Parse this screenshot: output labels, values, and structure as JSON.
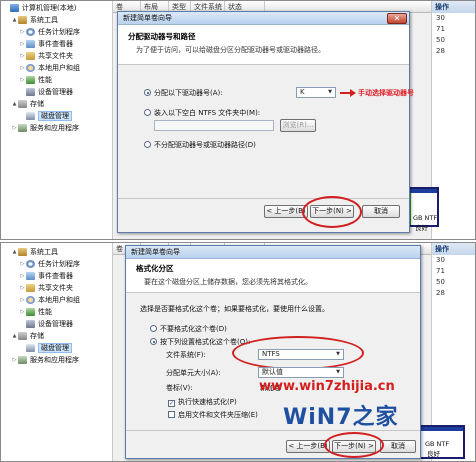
{
  "left_tree": {
    "top": [
      {
        "label": "计算机管理(本地)",
        "icon": "computer-icon",
        "indent": 0,
        "arrow": ""
      },
      {
        "label": "系统工具",
        "icon": "tools-icon",
        "indent": 1,
        "arrow": "▲"
      },
      {
        "label": "任务计划程序",
        "icon": "clock-icon",
        "indent": 2,
        "arrow": "▷"
      },
      {
        "label": "事件查看器",
        "icon": "event-log-icon",
        "indent": 2,
        "arrow": "▷"
      },
      {
        "label": "共享文件夹",
        "icon": "shared-folder-icon",
        "indent": 2,
        "arrow": "▷"
      },
      {
        "label": "本地用户和组",
        "icon": "users-icon",
        "indent": 2,
        "arrow": "▷"
      },
      {
        "label": "性能",
        "icon": "performance-icon",
        "indent": 2,
        "arrow": "▷"
      },
      {
        "label": "设备管理器",
        "icon": "device-manager-icon",
        "indent": 2,
        "arrow": ""
      },
      {
        "label": "存储",
        "icon": "storage-icon",
        "indent": 1,
        "arrow": "▲"
      },
      {
        "label": "磁盘管理",
        "icon": "disk-icon",
        "indent": 2,
        "arrow": "",
        "selected": true
      },
      {
        "label": "服务和应用程序",
        "icon": "services-icon",
        "indent": 1,
        "arrow": "▷"
      }
    ],
    "bottom": [
      {
        "label": "系统工具",
        "icon": "tools-icon",
        "indent": 1,
        "arrow": "▲"
      },
      {
        "label": "任务计划程序",
        "icon": "clock-icon",
        "indent": 2,
        "arrow": "▷"
      },
      {
        "label": "事件查看器",
        "icon": "event-log-icon",
        "indent": 2,
        "arrow": "▷"
      },
      {
        "label": "共享文件夹",
        "icon": "shared-folder-icon",
        "indent": 2,
        "arrow": "▷"
      },
      {
        "label": "本地用户和组",
        "icon": "users-icon",
        "indent": 2,
        "arrow": "▷"
      },
      {
        "label": "性能",
        "icon": "performance-icon",
        "indent": 2,
        "arrow": "▷"
      },
      {
        "label": "设备管理器",
        "icon": "device-manager-icon",
        "indent": 2,
        "arrow": ""
      },
      {
        "label": "存储",
        "icon": "storage-icon",
        "indent": 1,
        "arrow": "▲"
      },
      {
        "label": "磁盘管理",
        "icon": "disk-icon",
        "indent": 2,
        "arrow": "",
        "selected": true
      },
      {
        "label": "服务和应用程序",
        "icon": "services-icon",
        "indent": 1,
        "arrow": "▷"
      }
    ]
  },
  "bg_columns": [
    "卷",
    "布局",
    "类型",
    "文件系统",
    "状态"
  ],
  "actions": {
    "header": "操作",
    "top_values": [
      "30",
      "71",
      "50",
      "28"
    ],
    "bottom_values": [
      "30",
      "71",
      "50",
      "28"
    ]
  },
  "bg_texts": {
    "top_disk_label": "GB NTF",
    "top_disk_sub": "良好",
    "bottom_disk_label": "GB NTF",
    "bottom_disk_sub": "良好"
  },
  "dialog1": {
    "title": "新建简单卷向导",
    "close": "✕",
    "header_title": "分配驱动器号和路径",
    "header_desc": "为了便于访问，可以给磁盘分区分配驱动器号或驱动器路径。",
    "option_assign": "分配以下驱动器号(A):",
    "drive_letter": "K",
    "option_mount": "装入以下空白 NTFS 文件夹中(M):",
    "browse": "浏览(R)...",
    "option_none": "不分配驱动器号或驱动器路径(D)",
    "annotation": "手动选择驱动器号",
    "back": "< 上一步(B)",
    "next": "下一步(N) >",
    "cancel": "取消"
  },
  "dialog2": {
    "title": "新建简单卷向导",
    "close": "✕",
    "header_title": "格式化分区",
    "header_desc": "要在这个磁盘分区上储存数据，您必须先将其格式化。",
    "intro": "选择是否要格式化这个卷；如果要格式化，要使用什么设置。",
    "option_no_format": "不要格式化这个卷(D)",
    "option_format": "按下列设置格式化这个卷(O):",
    "fs_label": "文件系统(F):",
    "fs_value": "NTFS",
    "alloc_label": "分配单元大小(A):",
    "alloc_value": "默认值",
    "volume_label": "卷标(V):",
    "volume_value": "新加卷",
    "quick_format": "执行快速格式化(P)",
    "compression": "启用文件和文件夹压缩(E)",
    "back": "< 上一步(B)",
    "next": "下一步(N) >",
    "cancel": "取消"
  },
  "watermark": {
    "url": "www.win7zhijia.cn",
    "logo_main": "WiN",
    "logo_seven": "7",
    "logo_tail": "之家"
  },
  "colors": {
    "annotation_red": "#d22020",
    "dialog_title_bg": "#c9dcf2",
    "disk_bar_border": "#1c1c6e",
    "disk_bar_green": "#2e9e2e"
  }
}
